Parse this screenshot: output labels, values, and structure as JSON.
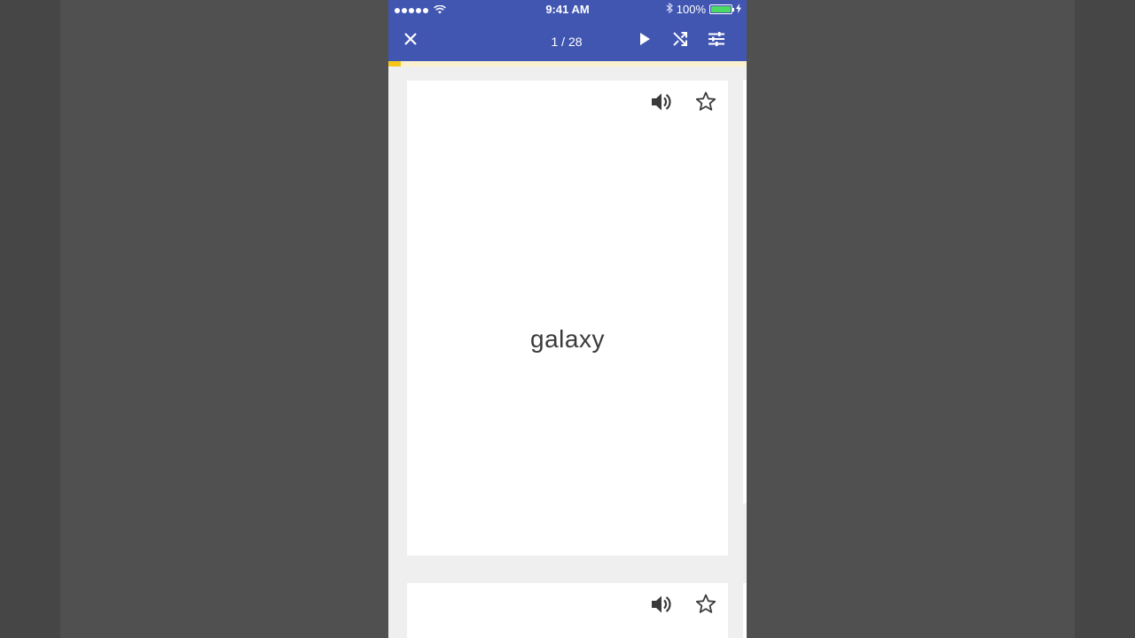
{
  "status_bar": {
    "time": "9:41 AM",
    "battery_percent": "100%",
    "battery_level": 1.0
  },
  "toolbar": {
    "counter": "1 / 28",
    "close_icon": "close-icon",
    "play_icon": "play-icon",
    "shuffle_icon": "shuffle-icon",
    "settings_icon": "tune-icon"
  },
  "progress": {
    "current": 1,
    "total": 28,
    "fraction": 0.0357
  },
  "cards": [
    {
      "term": "galaxy",
      "audio_icon": "speaker-icon",
      "star_icon": "star-outline-icon"
    },
    {
      "term": "",
      "audio_icon": "speaker-icon",
      "star_icon": "star-outline-icon"
    }
  ],
  "colors": {
    "header": "#4156b1",
    "progress_accent": "#f5c518",
    "progress_track": "#fbf1cf",
    "battery": "#4cd964"
  }
}
